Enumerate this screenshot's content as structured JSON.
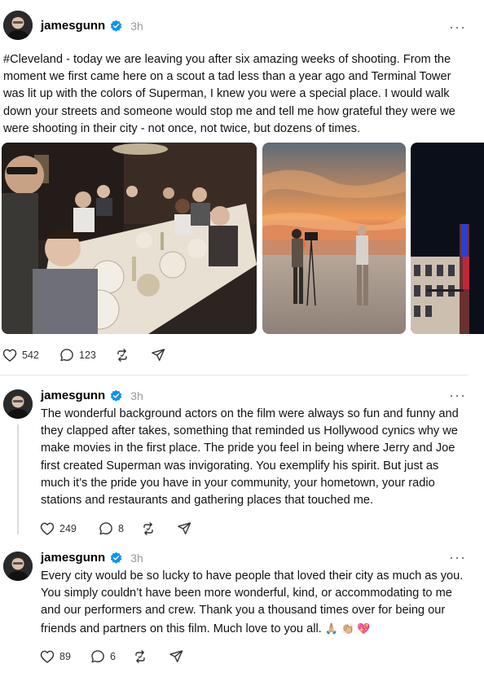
{
  "posts": [
    {
      "username": "jamesgunn",
      "time": "3h",
      "more": "···",
      "text": "#Cleveland - today we are leaving you after six amazing weeks of shooting. From the moment we first came here on a scout a tad less than a year ago and Terminal Tower was lit up with the colors of Superman, I knew you were a special place. I would walk down your streets and someone would stop me and tell me how grateful they were we were shooting in their city - not once, not twice, but dozens of times.",
      "likes": "542",
      "replies": "123"
    },
    {
      "username": "jamesgunn",
      "time": "3h",
      "more": "···",
      "text": "The wonderful background actors on the film were always so fun and funny and they clapped after takes, something that reminded us Hollywood cynics why we make movies in the first place. The pride you feel in being where Jerry and Joe first created Superman was invigorating. You exemplify his spirit. But just as much it’s the pride you have in your community, your hometown, your radio stations and restaurants and gathering places that touched me.",
      "likes": "249",
      "replies": "8"
    },
    {
      "username": "jamesgunn",
      "time": "3h",
      "more": "···",
      "text": "Every city would be so lucky to have people that loved their city as much as you. You simply couldn’t have been more wonderful, kind, or accommodating to me and our performers and crew. Thank you a thousand times over for being our friends and partners on this film. Much love to you all.",
      "emojis": "🙏🏼 👏🏼 💖",
      "likes": "89",
      "replies": "6"
    }
  ],
  "icons": [
    "heart-icon",
    "reply-icon",
    "repost-icon",
    "share-icon",
    "verified-icon",
    "more-icon"
  ],
  "colors": {
    "verified": "#0095f6",
    "meta_text": "#999999"
  }
}
